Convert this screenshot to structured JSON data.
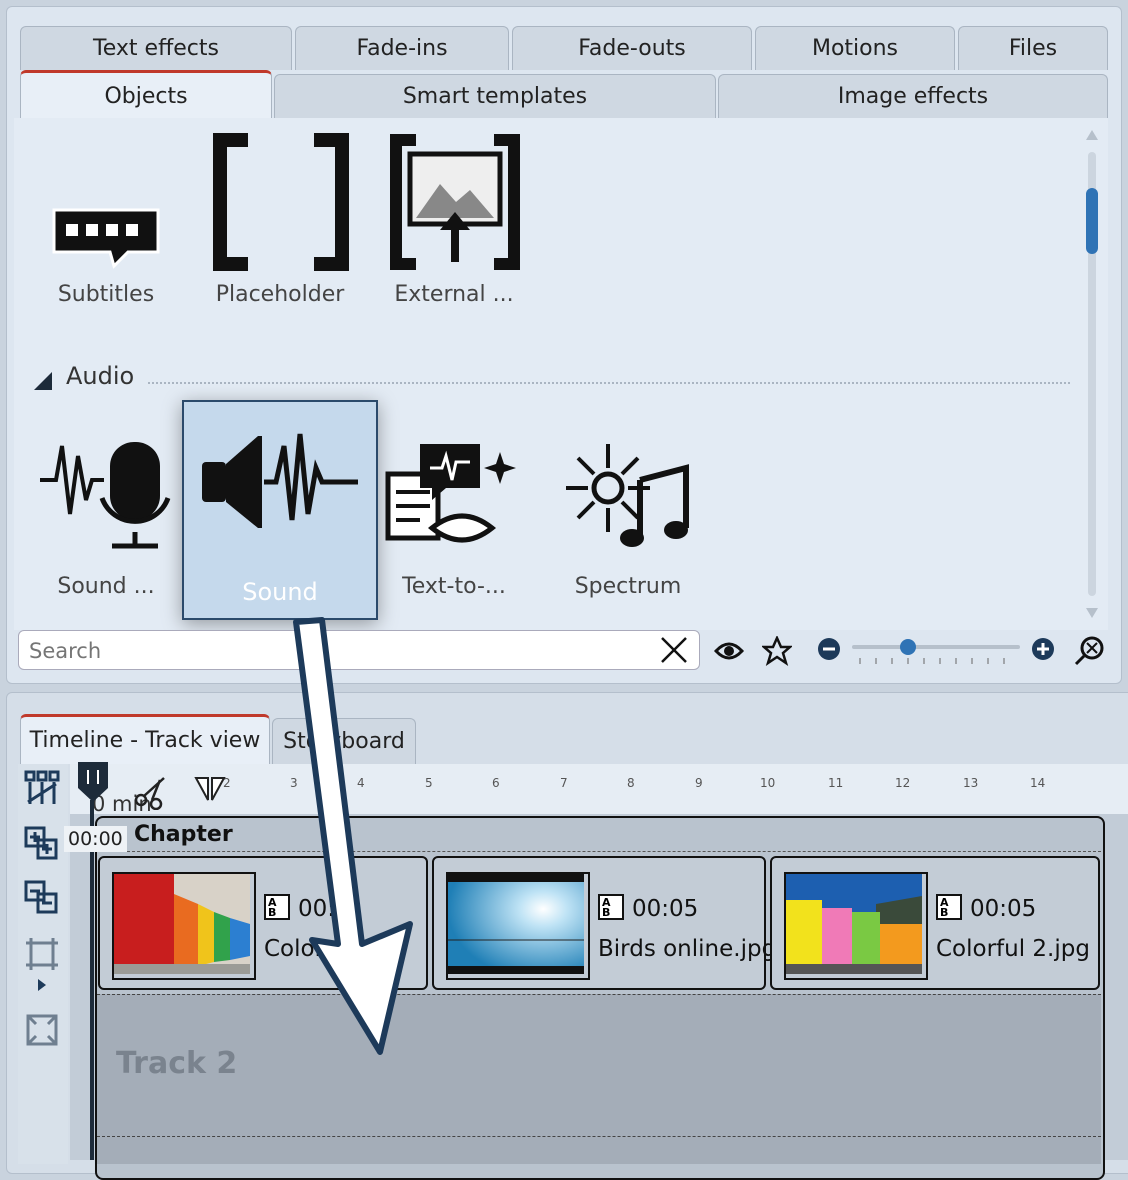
{
  "tabs_row1": [
    "Text effects",
    "Fade-ins",
    "Fade-outs",
    "Motions",
    "Files"
  ],
  "tabs_row2": [
    "Objects",
    "Smart templates",
    "Image effects"
  ],
  "objects": [
    "Subtitles",
    "Placeholder",
    "External ..."
  ],
  "audio_section": "Audio",
  "audio_items": [
    "Sound ...",
    "Sound",
    "Text-to-...",
    "Spectrum"
  ],
  "search": {
    "placeholder": "Search"
  },
  "bottom_tabs": [
    "Timeline - Track view",
    "Storyboard"
  ],
  "ruler": {
    "start_label": "0 min",
    "ticks": [
      "2",
      "3",
      "4",
      "5",
      "6",
      "7",
      "8",
      "9",
      "10",
      "11",
      "12",
      "13",
      "14"
    ],
    "time_badge": "00:00"
  },
  "chapter_label": "Chapter",
  "clips": [
    {
      "time": "00:0",
      "name": "Color"
    },
    {
      "time": "00:05",
      "name": "Birds online.jpg"
    },
    {
      "time": "00:05",
      "name": "Colorful 2.jpg"
    }
  ],
  "track2_label": "Track 2",
  "colors": {
    "accent_tab": "#c0392b",
    "selection": "#c5d9ec",
    "arrow_stroke": "#1d3a5a"
  }
}
